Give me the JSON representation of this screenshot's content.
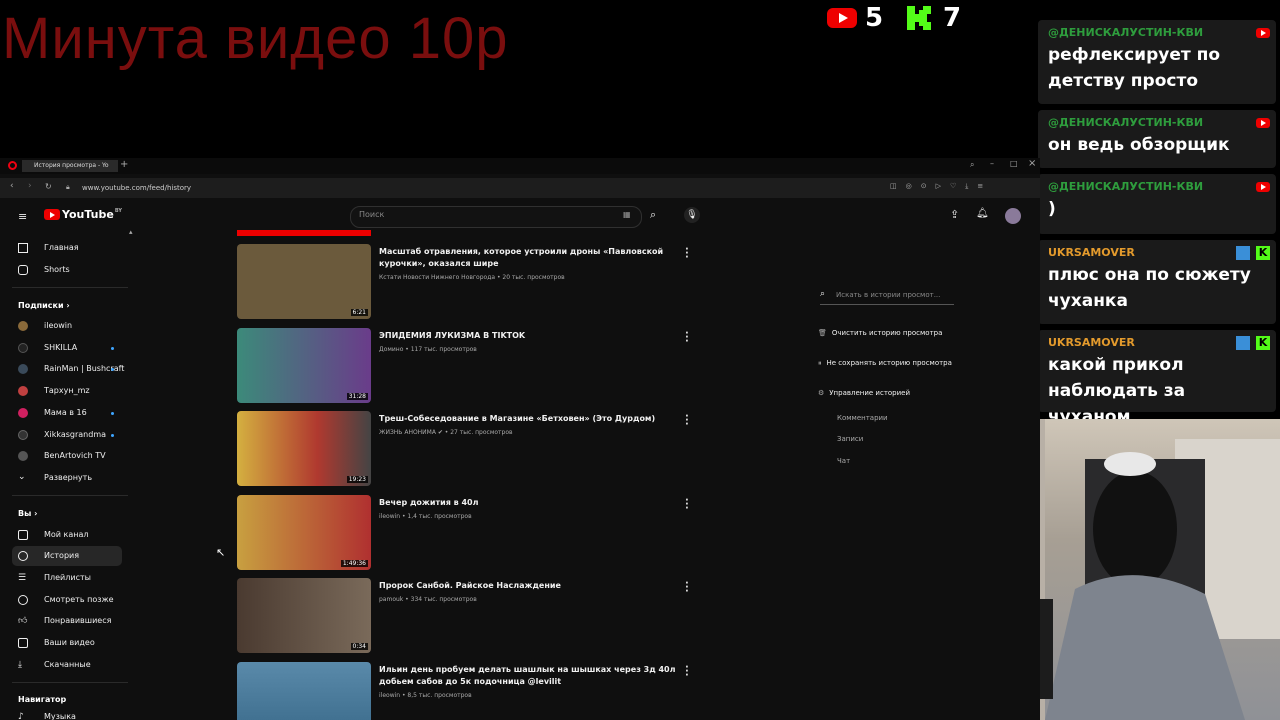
{
  "overlay": {
    "title": "Минута видео 10р",
    "youtube_count": "5",
    "kick_count": "7"
  },
  "chat": {
    "messages": [
      {
        "user": "@ДЕНИСКАЛУСТИН-КВИ",
        "user_color": "#2e9d3d",
        "text": "рефлексирует по детству просто",
        "platform": "youtube"
      },
      {
        "user": "@ДЕНИСКАЛУСТИН-КВИ",
        "user_color": "#2e9d3d",
        "text": "он ведь обзорщик",
        "platform": "youtube"
      },
      {
        "user": "@ДЕНИСКАЛУСТИН-КВИ",
        "user_color": "#2e9d3d",
        "text": ")",
        "platform": "youtube"
      },
      {
        "user": "UKRSAMOVER",
        "user_color": "#e39a2c",
        "text": "плюс она по сюжету чуханка",
        "platform": "kick"
      },
      {
        "user": "UKRSAMOVER",
        "user_color": "#e39a2c",
        "text": "какой прикол наблюдать за чуханом",
        "platform": "kick"
      }
    ]
  },
  "browser": {
    "tab_title": "История просмотра - Yo",
    "url": "www.youtube.com/feed/history"
  },
  "youtube": {
    "brand": "YouTube",
    "brand_region": "BY",
    "search_placeholder": "Поиск",
    "sidebar": {
      "home": "Главная",
      "shorts": "Shorts",
      "subscriptions_header": "Подписки",
      "subscriptions": [
        {
          "name": "ileowin",
          "live_dot": false,
          "color": "#8a6a3a"
        },
        {
          "name": "SHKILLA",
          "live_dot": true,
          "color": "#222222"
        },
        {
          "name": "RainMan | Bushcraft",
          "live_dot": true,
          "color": "#3a4a5a"
        },
        {
          "name": "Тархун_mz",
          "live_dot": false,
          "color": "#c04040"
        },
        {
          "name": "Мама в 16",
          "live_dot": true,
          "color": "#d02060"
        },
        {
          "name": "Xikkasgrandma",
          "live_dot": true,
          "color": "#333333"
        },
        {
          "name": "BenArtovich TV",
          "live_dot": false,
          "color": "#555555"
        }
      ],
      "expand": "Развернуть",
      "you_header": "Вы",
      "you_items": [
        "Мой канал",
        "История",
        "Плейлисты",
        "Смотреть позже",
        "Понравившиеся",
        "Ваши видео",
        "Скачанные"
      ],
      "navigator_header": "Навигатор",
      "music": "Музыка"
    },
    "videos": [
      {
        "title": "Масштаб отравления, которое устроили дроны «Павловской курочки», оказался шире",
        "meta": "Кстати Новости Нижнего Новгорода • 20 тыс. просмотров",
        "duration": "6:21",
        "thumb_color": "#6b5a3c"
      },
      {
        "title": "ЭПИДЕМИЯ ЛУКИЗМА В TIKTOK",
        "meta": "Домино • 117 тыс. просмотров",
        "duration": "31:28",
        "thumb_color": "#6a3c8a"
      },
      {
        "title": "Треш-Собеседование в Магазине «Бетховен» (Это Дурдом)",
        "meta": "ЖИЗНЬ АНОНИМА ✔ • 27 тыс. просмотров",
        "duration": "19:23",
        "thumb_color": "#b0392f"
      },
      {
        "title": "Вечер дожития в 40л",
        "meta": "ileowin • 1,4 тыс. просмотров",
        "duration": "1:49:36",
        "thumb_color": "#c8a040"
      },
      {
        "title": "Пророк Санбой. Райское Наслаждение",
        "meta": "pamouk • 334 тыс. просмотров",
        "duration": "0:34",
        "thumb_color": "#4a3a30"
      },
      {
        "title": "Ильин день пробуем делать шашлык на шышках через 3д 40л добьем сабов до 5к подочница @levilit",
        "meta": "ileowin • 8,5 тыс. просмотров",
        "duration": "",
        "thumb_color": "#3a6a8a"
      }
    ],
    "history_panel": {
      "search_placeholder": "Искать в истории просмот...",
      "clear": "Очистить историю просмотра",
      "pause": "Не сохранять историю просмотра",
      "manage": "Управление историей",
      "sub_items": [
        "Комментарии",
        "Записи",
        "Чат"
      ]
    }
  }
}
